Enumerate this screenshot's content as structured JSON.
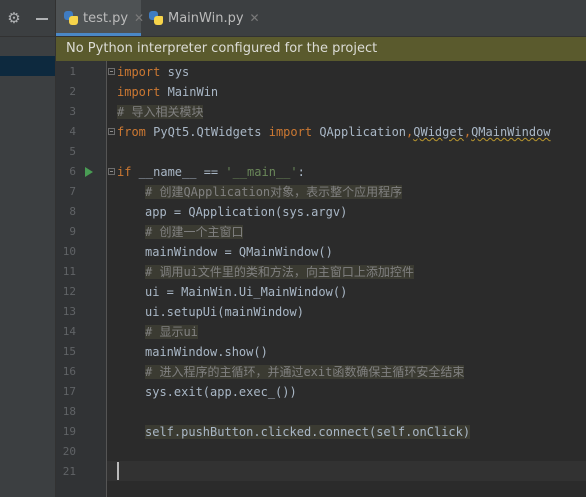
{
  "tabs": [
    {
      "label": "test.py",
      "active": true
    },
    {
      "label": "MainWin.py",
      "active": false
    }
  ],
  "banner": {
    "text": "No Python interpreter configured for the project"
  },
  "line_numbers": [
    "1",
    "2",
    "3",
    "4",
    "5",
    "6",
    "7",
    "8",
    "9",
    "10",
    "11",
    "12",
    "13",
    "14",
    "15",
    "16",
    "17",
    "18",
    "19",
    "20",
    "21"
  ],
  "code": {
    "l1_kw": "import",
    "l1_rest": " sys",
    "l2_kw": "import",
    "l2_rest": " MainWin",
    "l3": "# 导入相关模块",
    "l4_kw1": "from",
    "l4_mod": " PyQt5.QtWidgets ",
    "l4_kw2": "import",
    "l4_rest": " QApplication",
    "l4_c1": ",",
    "l4_w1": "QWidget",
    "l4_c2": ",",
    "l4_w2": "QMainWindow",
    "l6_kw": "if",
    "l6_mid": " __name__ == ",
    "l6_str": "'__main__'",
    "l6_end": ":",
    "l7": "# 创建QApplication对象，表示整个应用程序",
    "l8": "app = QApplication(sys.argv)",
    "l9": "# 创建一个主窗口",
    "l10": "mainWindow = QMainWindow()",
    "l11": "# 调用ui文件里的类和方法，向主窗口上添加控件",
    "l12": "ui = MainWin.Ui_MainWindow()",
    "l13": "ui.setupUi(mainWindow)",
    "l14": "# 显示ui",
    "l15": "mainWindow.show()",
    "l16": "# 进入程序的主循环，并通过exit函数确保主循环安全结束",
    "l17": "sys.exit(app.exec_())",
    "l19": "self.pushButton.clicked.connect(self.onClick)"
  },
  "colors": {
    "keyword": "#cc7832",
    "string": "#6a8759",
    "comment": "#808080",
    "banner_bg": "#5a5a2d",
    "accent": "#4a88c7"
  },
  "icons": {
    "toolbar": [
      "gear-icon",
      "minimize-icon"
    ],
    "tab": "python-file-icon",
    "gutter": "run-arrow-icon"
  }
}
